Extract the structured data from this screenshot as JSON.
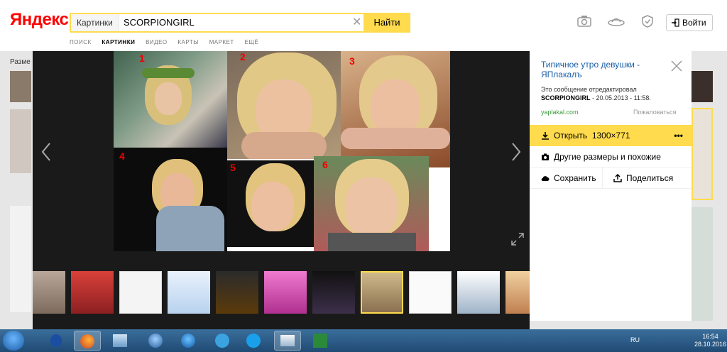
{
  "header": {
    "logo_text": "Яндекс",
    "search": {
      "tag": "Картинки",
      "query": "SCORPIONGIRL",
      "button": "Найти"
    },
    "login_label": "Войти",
    "nav": [
      "ПОИСК",
      "КАРТИНКИ",
      "ВИДЕО",
      "КАРТЫ",
      "МАРКЕТ",
      "ЕЩЁ"
    ],
    "behind_label": "Разме"
  },
  "viewer": {
    "photo_numbers": [
      "1",
      "2",
      "3",
      "4",
      "5",
      "6"
    ]
  },
  "panel": {
    "title": "Типичное утро девушки - ЯПлакалъ",
    "desc_prefix": "Это сообщение отредактировал",
    "desc_user": "SCORPIONGIRL",
    "desc_suffix": "- 20.05.2013 - 11:58.",
    "domain": "yaplakal.com",
    "report": "Пожаловаться",
    "open_label": "Открыть",
    "open_size": "1300×771",
    "sizes_label": "Другие размеры и похожие",
    "save_label": "Сохранить",
    "share_label": "Поделиться"
  },
  "taskbar": {
    "lang": "RU",
    "time": "16:54",
    "date": "28.10.2016"
  },
  "colors": {
    "accent_yellow": "#ffdb4d",
    "link_blue": "#1a5fa8",
    "domain_green": "#3a9b3a"
  }
}
